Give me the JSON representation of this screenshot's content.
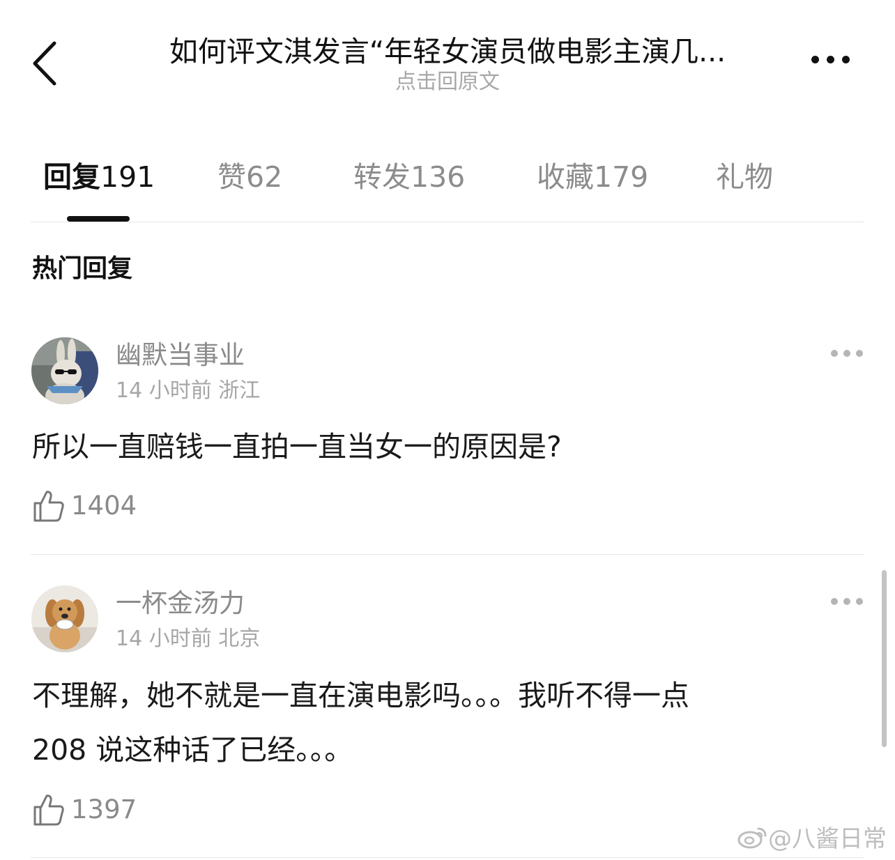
{
  "header": {
    "title": "如何评文淇发言“年轻女演员做电影主演几...",
    "subtitle": "点击回原文"
  },
  "tabs": [
    {
      "label": "回复",
      "count": "191",
      "active": true
    },
    {
      "label": "赞",
      "count": "62"
    },
    {
      "label": "转发",
      "count": "136"
    },
    {
      "label": "收藏",
      "count": "179"
    },
    {
      "label": "礼物",
      "count": ""
    }
  ],
  "section": {
    "title": "热门回复"
  },
  "comments": [
    {
      "username": "幽默当事业",
      "time": "14 小时前",
      "location": "浙江",
      "lines": [
        "所以一直赔钱一直拍一直当女一的原因是?"
      ],
      "likes": "1404",
      "avatar_icon": "rabbit-with-sunglasses-avatar"
    },
    {
      "username": "一杯金汤力",
      "time": "14 小时前",
      "location": "北京",
      "lines": [
        "不理解，她不就是一直在演电影吗。。。我听不得一点",
        "208 说这种话了已经。。。"
      ],
      "likes": "1397",
      "avatar_icon": "puppy-avatar"
    }
  ],
  "watermark": "@八酱日常",
  "icons": {
    "back": "chevron-left-icon",
    "more": "more-dots-icon",
    "like": "thumbs-up-icon",
    "watermark_logo": "weibo-logo-icon"
  }
}
